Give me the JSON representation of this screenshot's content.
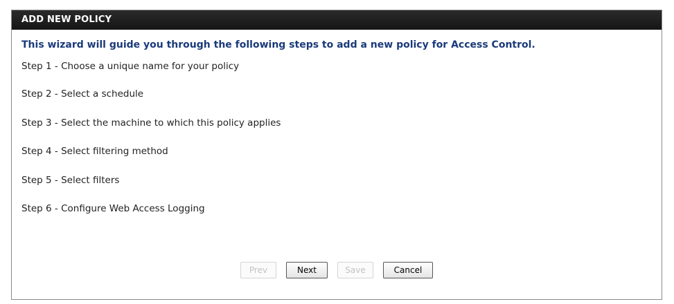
{
  "header": {
    "title": "ADD NEW POLICY"
  },
  "intro": "This wizard will guide you through the following steps to add a new policy for Access Control.",
  "steps": [
    {
      "label": "Step 1 - Choose a unique name for your policy"
    },
    {
      "label": "Step 2 - Select a schedule"
    },
    {
      "label": "Step 3 - Select the machine to which this policy applies"
    },
    {
      "label": "Step 4 - Select filtering method"
    },
    {
      "label": "Step 5 - Select filters"
    },
    {
      "label": "Step 6 - Configure Web Access Logging"
    }
  ],
  "buttons": {
    "prev": {
      "label": "Prev",
      "enabled": false
    },
    "next": {
      "label": "Next",
      "enabled": true
    },
    "save": {
      "label": "Save",
      "enabled": false
    },
    "cancel": {
      "label": "Cancel",
      "enabled": true
    }
  },
  "colors": {
    "header_bg": "#1e1e1e",
    "header_text": "#ffffff",
    "intro_text": "#1a3a7a",
    "body_text": "#222222",
    "disabled_text": "#c2c2c2"
  }
}
